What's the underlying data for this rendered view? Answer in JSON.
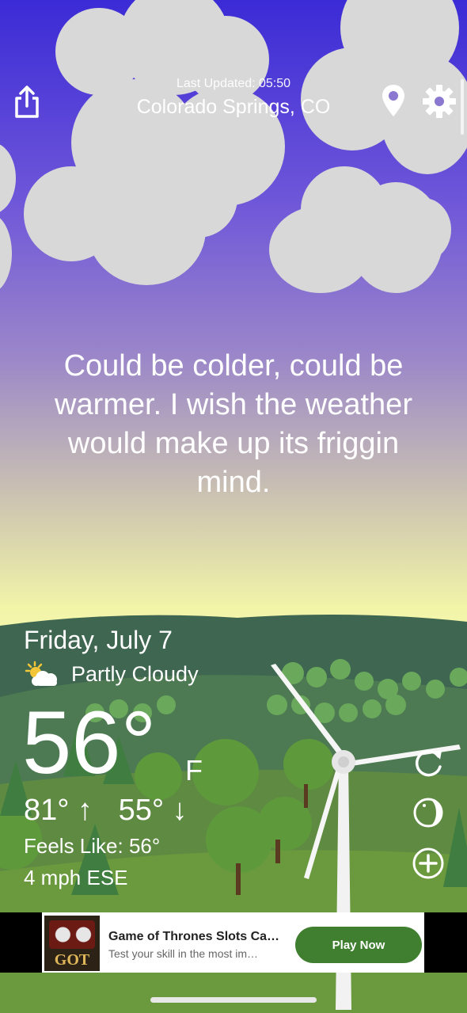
{
  "header": {
    "last_updated": "Last Updated: 05:50",
    "location": "Colorado Springs, CO",
    "share_icon": "share-icon",
    "location_icon": "location-pin-icon",
    "settings_icon": "gear-icon"
  },
  "quote": "Could be colder, could be warmer. I wish the weather would make up its friggin mind.",
  "current": {
    "date": "Friday, July 7",
    "condition": "Partly Cloudy",
    "condition_icon": "partly-cloudy-icon",
    "temperature": "56°",
    "unit": "F",
    "high": "81°",
    "low": "55°",
    "feels_like": "Feels Like: 56°",
    "wind": "4 mph ESE"
  },
  "side_actions": [
    {
      "name": "refresh",
      "icon": "refresh-icon"
    },
    {
      "name": "theme",
      "icon": "moon-icon"
    },
    {
      "name": "add",
      "icon": "add-circle-icon"
    }
  ],
  "ad": {
    "image_text": "GOT",
    "title": "Game of Thrones Slots Ca…",
    "subtitle": "Test your skill in the most im…",
    "button": "Play Now"
  },
  "colors": {
    "sky_top": "#3b2bd6",
    "sky_horizon": "#f6f9b3",
    "hill": "#4e7a5a",
    "ad_button": "#3f7f2f"
  }
}
